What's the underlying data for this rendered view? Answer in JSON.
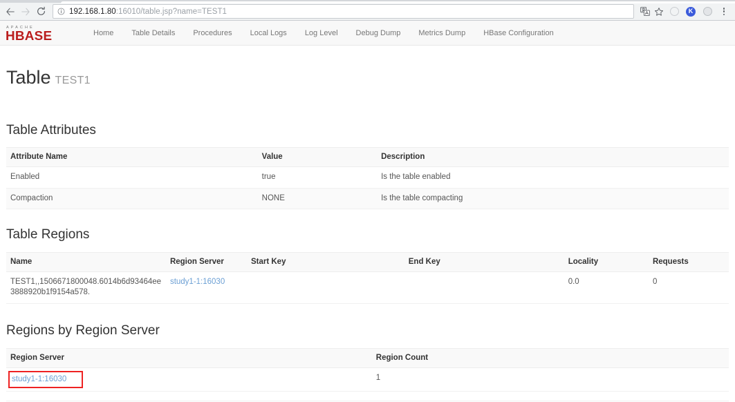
{
  "browser": {
    "back_icon": "back-arrow-icon",
    "forward_icon": "forward-arrow-icon",
    "reload_icon": "reload-icon",
    "site_info_icon": "info-circle-icon",
    "url_host": "192.168.1.80",
    "url_rest": ":16010/table.jsp?name=TEST1",
    "url_full": "192.168.1.80:16010/table.jsp?name=TEST1",
    "translate_icon": "translate-icon",
    "bookmark_icon": "star-icon",
    "extension1_icon": "circle-outline-icon",
    "extension2_label": "K",
    "extension2_icon": "k-badge-icon",
    "extension3_icon": "gray-circle-icon",
    "menu_icon": "kebab-menu-icon"
  },
  "navbar": {
    "logo_top": "A P A C H E",
    "logo_main": "HBASE",
    "links": [
      {
        "label": "Home"
      },
      {
        "label": "Table Details"
      },
      {
        "label": "Procedures"
      },
      {
        "label": "Local Logs"
      },
      {
        "label": "Log Level"
      },
      {
        "label": "Debug Dump"
      },
      {
        "label": "Metrics Dump"
      },
      {
        "label": "HBase Configuration"
      }
    ]
  },
  "page": {
    "title": "Table",
    "title_suffix": "TEST1"
  },
  "table_attributes": {
    "heading": "Table Attributes",
    "columns": [
      "Attribute Name",
      "Value",
      "Description"
    ],
    "rows": [
      {
        "name": "Enabled",
        "value": "true",
        "description": "Is the table enabled"
      },
      {
        "name": "Compaction",
        "value": "NONE",
        "description": "Is the table compacting"
      }
    ]
  },
  "table_regions": {
    "heading": "Table Regions",
    "columns": [
      "Name",
      "Region Server",
      "Start Key",
      "End Key",
      "Locality",
      "Requests"
    ],
    "rows": [
      {
        "name": "TEST1,,1506671800048.6014b6d93464ee3888920b1f9154a578.",
        "region_server": "study1-1:16030",
        "start_key": "",
        "end_key": "",
        "locality": "0.0",
        "requests": "0"
      }
    ]
  },
  "regions_by_region_server": {
    "heading": "Regions by Region Server",
    "columns": [
      "Region Server",
      "Region Count"
    ],
    "rows": [
      {
        "region_server": "study1-1:16030",
        "region_count": "1"
      }
    ],
    "highlight_color": "#ee2222"
  }
}
